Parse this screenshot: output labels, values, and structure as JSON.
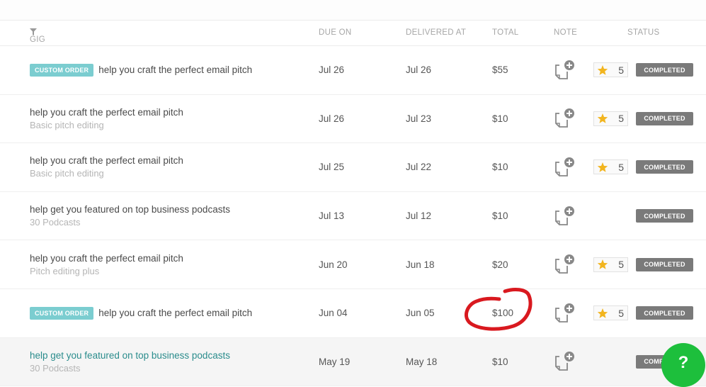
{
  "table": {
    "headers": {
      "gig": "GIG",
      "due_on": "DUE ON",
      "delivered_at": "DELIVERED AT",
      "total": "TOTAL",
      "note": "NOTE",
      "status": "STATUS"
    },
    "rows": [
      {
        "badge": "CUSTOM ORDER",
        "title": "help you craft the perfect email pitch",
        "subtitle": "",
        "due_on": "Jul 26",
        "delivered_at": "Jul 26",
        "total": "$55",
        "rating": "5",
        "status": "COMPLETED"
      },
      {
        "badge": "",
        "title": "help you craft the perfect email pitch",
        "subtitle": "Basic pitch editing",
        "due_on": "Jul 26",
        "delivered_at": "Jul 23",
        "total": "$10",
        "rating": "5",
        "status": "COMPLETED"
      },
      {
        "badge": "",
        "title": "help you craft the perfect email pitch",
        "subtitle": "Basic pitch editing",
        "due_on": "Jul 25",
        "delivered_at": "Jul 22",
        "total": "$10",
        "rating": "5",
        "status": "COMPLETED"
      },
      {
        "badge": "",
        "title": "help get you featured on top business podcasts",
        "subtitle": "30 Podcasts",
        "due_on": "Jul 13",
        "delivered_at": "Jul 12",
        "total": "$10",
        "rating": "",
        "status": "COMPLETED"
      },
      {
        "badge": "",
        "title": "help you craft the perfect email pitch",
        "subtitle": "Pitch editing plus",
        "due_on": "Jun 20",
        "delivered_at": "Jun 18",
        "total": "$20",
        "rating": "5",
        "status": "COMPLETED"
      },
      {
        "badge": "CUSTOM ORDER",
        "title": "help you craft the perfect email pitch",
        "subtitle": "",
        "due_on": "Jun 04",
        "delivered_at": "Jun 05",
        "total": "$100",
        "rating": "5",
        "status": "COMPLETED"
      },
      {
        "badge": "",
        "title": "help get you featured on top business podcasts",
        "subtitle": "30 Podcasts",
        "due_on": "May 19",
        "delivered_at": "May 18",
        "total": "$10",
        "rating": "",
        "status": "COMPLETED"
      }
    ]
  },
  "icons": {
    "filter": "filter-icon",
    "note": "note-add-icon",
    "star": "star-icon",
    "help": "help-icon"
  },
  "help_button": {
    "label": "?"
  },
  "colors": {
    "badge": "#7bcdd0",
    "status": "#7a7a7a",
    "star": "#f2b51f",
    "help": "#1dbf3c",
    "annotation": "#d9191f"
  }
}
